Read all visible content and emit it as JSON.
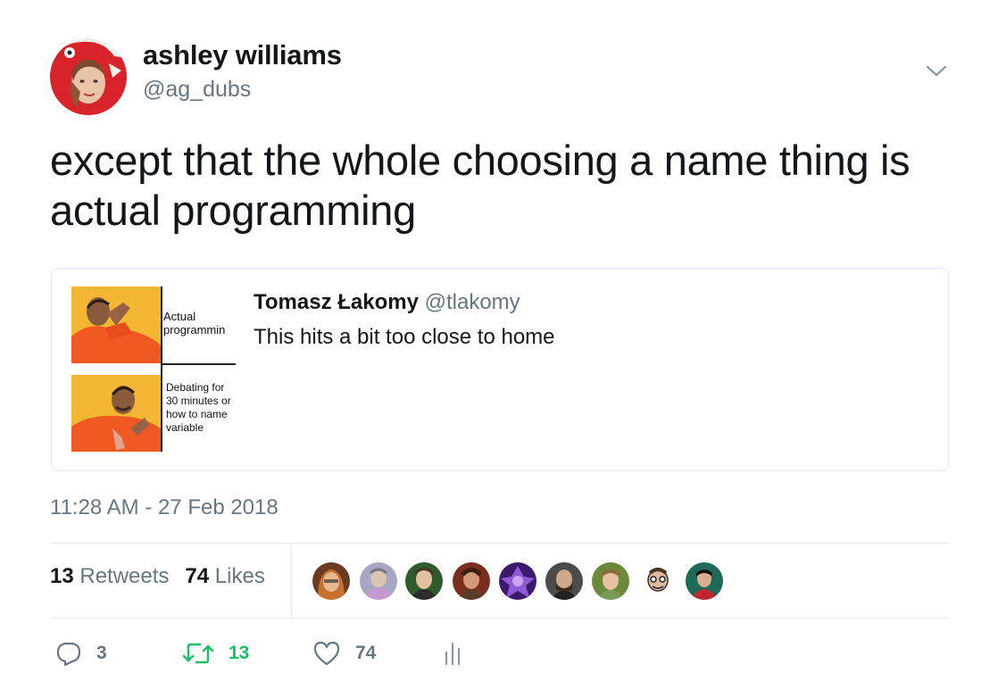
{
  "author": {
    "name": "ashley williams",
    "handle": "@ag_dubs"
  },
  "tweet": {
    "text": "except that the whole choosing a name thing is actual programming"
  },
  "quoted": {
    "name": "Tomasz Łakomy",
    "handle": "@tlakomy",
    "text": "This hits a bit too close to home",
    "meme": {
      "caption_top": "Actual programmin",
      "caption_bottom_lines": [
        "Debating for",
        "30 minutes or",
        "how to name",
        "variable"
      ]
    }
  },
  "timestamp": "11:28 AM - 27 Feb 2018",
  "stats": {
    "retweets_count": "13",
    "retweets_label": "Retweets",
    "likes_count": "74",
    "likes_label": "Likes"
  },
  "actions": {
    "reply_count": "3",
    "retweet_count": "13",
    "like_count": "74"
  },
  "colors": {
    "retweet_green": "#17bf63",
    "secondary_text": "#657786",
    "action_gray": "#657786",
    "border": "#e1e8ed"
  },
  "icons": [
    "chevron-down-icon",
    "reply-icon",
    "retweet-icon",
    "like-icon",
    "analytics-icon"
  ]
}
